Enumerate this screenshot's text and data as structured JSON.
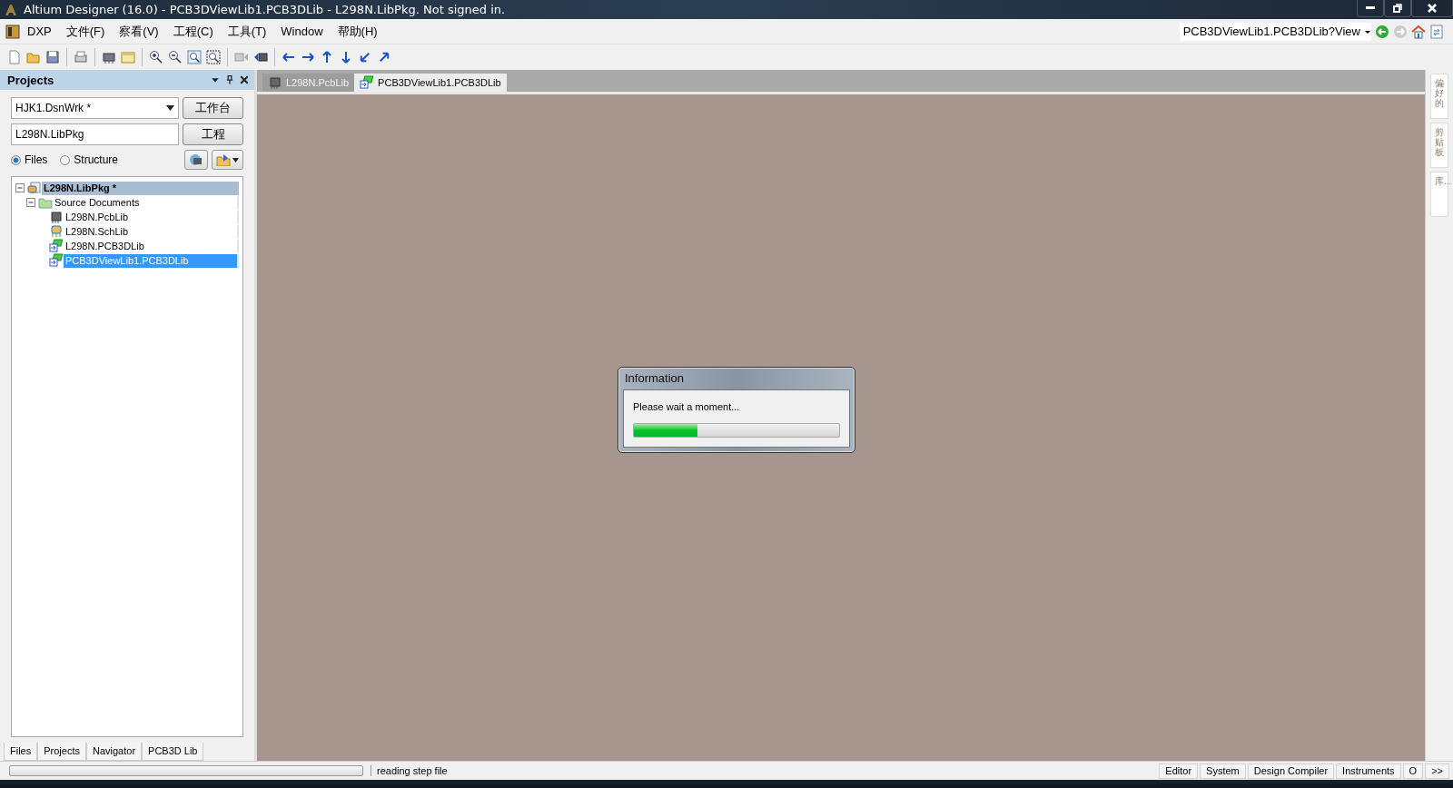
{
  "window": {
    "title": "Altium Designer (16.0) - PCB3DViewLib1.PCB3DLib - L298N.LibPkg. Not signed in."
  },
  "menu": [
    {
      "label": "DXP"
    },
    {
      "label": "文件(F)"
    },
    {
      "label": "察看(V)"
    },
    {
      "label": "工程(C)"
    },
    {
      "label": "工具(T)"
    },
    {
      "label": "Window"
    },
    {
      "label": "帮助(H)"
    }
  ],
  "nav_bar": {
    "address": "PCB3DViewLib1.PCB3DLib?View"
  },
  "projects_panel": {
    "title": "Projects",
    "workspace": "HJK1.DsnWrk *",
    "workspace_button": "工作台",
    "project": "L298N.LibPkg",
    "project_button": "工程",
    "view_modes": [
      {
        "label": "Files",
        "selected": true
      },
      {
        "label": "Structure",
        "selected": false
      }
    ],
    "tree": [
      {
        "label": "L298N.LibPkg *",
        "kind": "package",
        "expanded": true,
        "current": true,
        "selected": false,
        "children": [
          {
            "label": "Source Documents",
            "kind": "folder",
            "expanded": true,
            "current": false,
            "selected": false,
            "children": [
              {
                "label": "L298N.PcbLib",
                "kind": "pcb-lib",
                "current": false,
                "selected": false
              },
              {
                "label": "L298N.SchLib",
                "kind": "sch-lib",
                "current": false,
                "selected": false
              },
              {
                "label": "L298N.PCB3DLib",
                "kind": "pcb3d-lib",
                "current": false,
                "selected": false
              },
              {
                "label": "PCB3DViewLib1.PCB3DLib",
                "kind": "pcb3d-lib",
                "current": false,
                "selected": true
              }
            ]
          }
        ]
      }
    ],
    "tabs": [
      {
        "label": "Files"
      },
      {
        "label": "Projects"
      },
      {
        "label": "Navigator"
      },
      {
        "label": "PCB3D Lib"
      }
    ]
  },
  "document_tabs": [
    {
      "label": "L298N.PcbLib",
      "kind": "pcb-lib",
      "selected": false
    },
    {
      "label": "PCB3DViewLib1.PCB3DLib",
      "kind": "pcb3d-lib",
      "selected": true
    }
  ],
  "right_panels": [
    {
      "label": "偏好的"
    },
    {
      "label": "剪贴板"
    },
    {
      "label": "库..."
    }
  ],
  "dialog": {
    "title": "Information",
    "message": "Please wait a moment...",
    "progress": {
      "level": 0.31
    }
  },
  "status_bar": {
    "progress": {
      "level": 0
    },
    "message": "reading step file",
    "panel_buttons": [
      {
        "label": "Editor"
      },
      {
        "label": "System"
      },
      {
        "label": "Design Compiler"
      },
      {
        "label": "Instruments"
      },
      {
        "label": "O"
      },
      {
        "label": ">>"
      }
    ]
  }
}
